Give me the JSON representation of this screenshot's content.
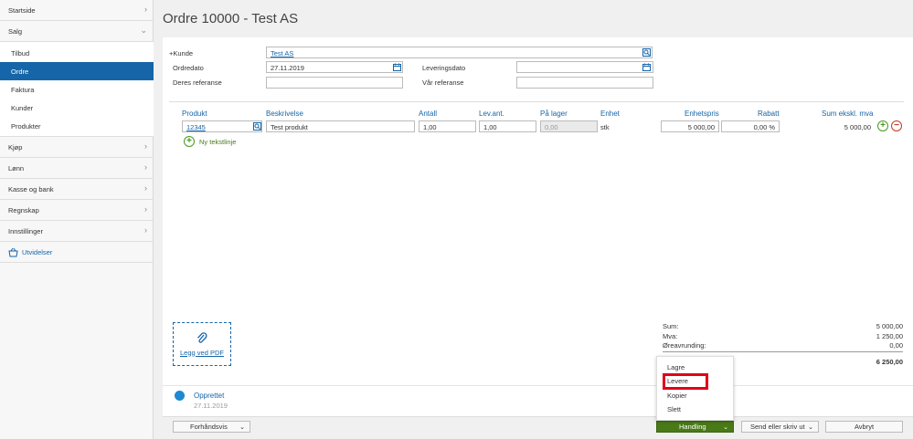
{
  "sidebar": {
    "items": [
      {
        "label": "Startside",
        "chevron": "›"
      },
      {
        "label": "Salg",
        "chevron": "⌄"
      },
      {
        "label": "Kjøp",
        "chevron": "›"
      },
      {
        "label": "Lønn",
        "chevron": "›"
      },
      {
        "label": "Kasse og bank",
        "chevron": "›"
      },
      {
        "label": "Regnskap",
        "chevron": "›"
      },
      {
        "label": "Innstillinger",
        "chevron": "›"
      }
    ],
    "sub_items": [
      "Tilbud",
      "Ordre",
      "Faktura",
      "Kunder",
      "Produkter"
    ],
    "extensions_label": "Utvidelser"
  },
  "page_title": "Ordre 10000 - Test AS",
  "form": {
    "customer_label": "+Kunde",
    "customer_value": "Test AS",
    "order_date_label": "Ordredato",
    "order_date_value": "27.11.2019",
    "delivery_date_label": "Leveringsdato",
    "delivery_date_value": "",
    "their_ref_label": "Deres referanse",
    "their_ref_value": "",
    "our_ref_label": "Vår referanse",
    "our_ref_value": ""
  },
  "table": {
    "headers": [
      "Produkt",
      "Beskrivelse",
      "Antall",
      "Lev.ant.",
      "På lager",
      "Enhet",
      "Enhetspris",
      "Rabatt",
      "Sum ekskl. mva"
    ],
    "row": {
      "product": "12345",
      "description": "Test produkt",
      "quantity": "1,00",
      "delivered": "1,00",
      "in_stock": "0,00",
      "unit": "stk",
      "unit_price": "5 000,00",
      "discount": "0,00 %",
      "sum": "5 000,00"
    },
    "add_line_label": "Ny tekstlinje"
  },
  "attach": {
    "label": "Legg ved PDF"
  },
  "totals": {
    "sum_label": "Sum:",
    "sum_value": "5 000,00",
    "vat_label": "Mva:",
    "vat_value": "1 250,00",
    "rounding_label": "Øreavrunding:",
    "rounding_value": "0,00",
    "total_value": "6 250,00"
  },
  "status": {
    "label": "Opprettet",
    "date": "27.11.2019"
  },
  "footer": {
    "preview_label": "Forhåndsvis",
    "action_label": "Handling",
    "send_label": "Send eller skriv ut",
    "cancel_label": "Avbryt"
  },
  "action_menu": [
    "Lagre",
    "Levere",
    "Kopier",
    "Slett"
  ],
  "colors": {
    "primary": "#1565a8",
    "action_green": "#4a7a18",
    "highlight_red": "#e0001a"
  }
}
